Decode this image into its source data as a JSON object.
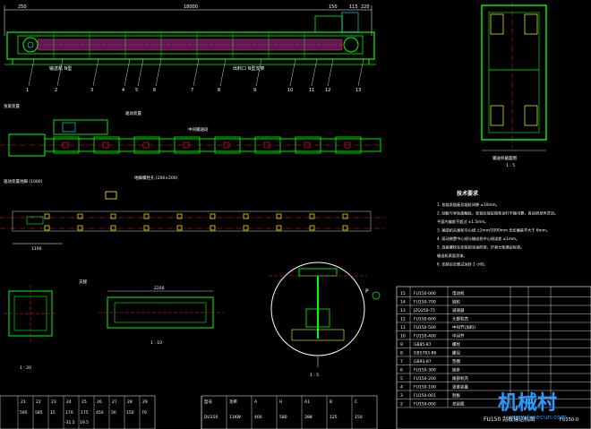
{
  "main_view": {
    "dims": [
      "250",
      "18000",
      "150",
      "115",
      "220"
    ],
    "label_a": "输送机 N型",
    "label_b": "出料口 N型支架",
    "callouts": [
      "1",
      "2",
      "3",
      "4",
      "5",
      "6",
      "7",
      "8",
      "9",
      "10",
      "11",
      "12",
      "13"
    ]
  },
  "plan_view": {
    "notes": [
      "张紧装置",
      "驱动装置"
    ],
    "label_mid": "中间输送段"
  },
  "section_view": {
    "caption": "输送机截面图",
    "scale": "1 : 5"
  },
  "support_view": {
    "notes": [
      "驱动装置地脚 (1000)",
      "地脚螺栓孔 (200×200)"
    ],
    "dim_bottom": "1100"
  },
  "tech_req": {
    "title": "技术要求",
    "items": [
      "1. 各链条链板及链轮间隙 ≤10mm。",
      "2. 刮板与导轨接触处，安装后保证链条运行平稳可靠，各运转部件灵活。",
      "   平面内偏差不超过 ±1.5mm。",
      "3. 输送机头尾轮中心线 ±2mm/1000mm 全长偏差不大于 6mm。",
      "4. 驱动装置中心线与输送机中心线误差 ≤1mm。",
      "5. 连接螺栓在安装前涂油防锈，拧紧力矩满足标准。",
      "   输送机表面涂漆。",
      "6. 安装后空载试运转 2 小时。"
    ]
  },
  "detail_views": {
    "left_scale": "1 : 20",
    "mid_label": "支腿",
    "mid_scale": "1 : 10",
    "mid_dim": "2200",
    "circle_scale": "1 : 5",
    "circle_tag": "P"
  },
  "bom": {
    "rows": [
      {
        "no": "15",
        "code": "FU150-000",
        "name": "电动机"
      },
      {
        "no": "14",
        "code": "FU150-700",
        "name": "链轮"
      },
      {
        "no": "13",
        "code": "JZQ250-75",
        "name": "减速器"
      },
      {
        "no": "12",
        "code": "FU150-600",
        "name": "头部机壳"
      },
      {
        "no": "11",
        "code": "FU150-500",
        "name": "中间节(加料)"
      },
      {
        "no": "10",
        "code": "FU150-400",
        "name": "中间节"
      },
      {
        "no": "9",
        "code": "GB85-87",
        "name": "螺栓"
      },
      {
        "no": "8",
        "code": "GB5783-86",
        "name": "螺母"
      },
      {
        "no": "7",
        "code": "GB93-87",
        "name": "垫圈"
      },
      {
        "no": "6",
        "code": "FU150-300",
        "name": "链条"
      },
      {
        "no": "5",
        "code": "FU150-200",
        "name": "尾部机壳"
      },
      {
        "no": "4",
        "code": "FU150-100",
        "name": "张紧装置"
      },
      {
        "no": "3",
        "code": "FU150-001",
        "name": "刮板"
      },
      {
        "no": "2",
        "code": "FU150-000",
        "name": "总装图"
      }
    ],
    "title_block": "FU150 刮板输送机图",
    "drawing_no": "FU150-0"
  },
  "bottom_tables": {
    "left_headers": [
      "21",
      "22",
      "23",
      "24",
      "25",
      "26",
      "27",
      "28",
      "29"
    ],
    "left_values": [
      "595",
      "585",
      "15",
      "170",
      "175",
      "450",
      "50",
      "150",
      "70"
    ],
    "left_values2": [
      "",
      "",
      "",
      "-31.5",
      "19.5",
      "",
      "",
      "",
      ""
    ],
    "right_headers": [
      "型号",
      "功率",
      "A",
      "H",
      "A1",
      "B",
      "C"
    ],
    "right_values": [
      "DU150",
      "11KW",
      "400",
      "580",
      "288",
      "125",
      "150"
    ]
  },
  "watermark": {
    "brand": "机械村",
    "url": "www.Jixiecun.com"
  }
}
